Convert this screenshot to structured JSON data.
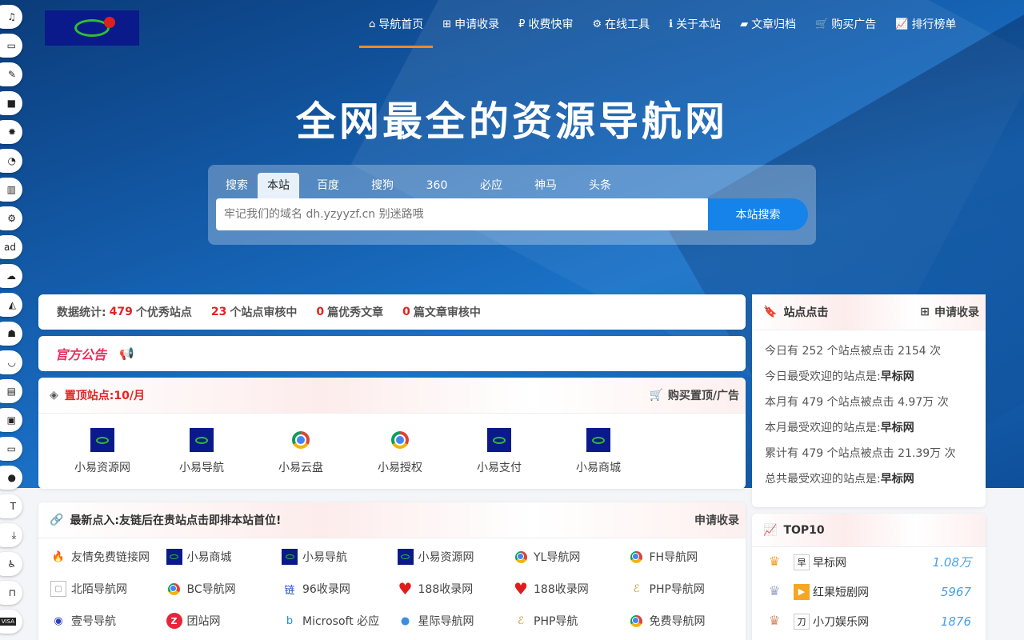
{
  "header": {
    "nav": [
      {
        "icon": "home-icon",
        "glyph": "⌂",
        "label": "导航首页",
        "active": true
      },
      {
        "icon": "plus-square-icon",
        "glyph": "⊞",
        "label": "申请收录"
      },
      {
        "icon": "ruble-icon",
        "glyph": "₽",
        "label": "收费快审"
      },
      {
        "icon": "cogs-icon",
        "glyph": "⚙",
        "label": "在线工具"
      },
      {
        "icon": "info-icon",
        "glyph": "ℹ",
        "label": "关于本站"
      },
      {
        "icon": "folder-open-icon",
        "glyph": "▰",
        "label": "文章归档"
      },
      {
        "icon": "cart-icon",
        "glyph": "🛒",
        "label": "购买广告"
      },
      {
        "icon": "line-chart-icon",
        "glyph": "📈",
        "label": "排行榜单"
      }
    ]
  },
  "hero": {
    "title": "全网最全的资源导航网"
  },
  "search": {
    "tabs": [
      "搜索",
      "本站",
      "百度",
      "搜狗",
      "360",
      "必应",
      "神马",
      "头条"
    ],
    "active_tab": "本站",
    "placeholder": "牢记我们的域名 dh.yzyyzf.cn 别迷路哦",
    "button": "本站搜索"
  },
  "stats": {
    "prefix": "数据统计:",
    "sites": "479",
    "sites_label": "个优秀站点",
    "review": "23",
    "review_label": "个站点审核中",
    "articles": "0",
    "articles_label": "篇优秀文章",
    "articles_review": "0",
    "articles_review_label": "篇文章审核中"
  },
  "notice": {
    "title": "官方公告"
  },
  "top_sites": {
    "title_prefix": "置顶站点:",
    "title_price": "10/月",
    "buy_label": "购买置顶/广告",
    "items": [
      {
        "name": "小易资源网",
        "icon": "navy"
      },
      {
        "name": "小易导航",
        "icon": "navy"
      },
      {
        "name": "小易云盘",
        "icon": "chrome"
      },
      {
        "name": "小易授权",
        "icon": "chrome"
      },
      {
        "name": "小易支付",
        "icon": "navy"
      },
      {
        "name": "小易商城",
        "icon": "navy"
      }
    ]
  },
  "latest": {
    "title": "最新点入:友链后在贵站点击即排本站首位!",
    "apply_label": "申请收录",
    "links": [
      {
        "name": "友情免费链接网",
        "icon": "flame",
        "glyph": "🔥"
      },
      {
        "name": "小易商城",
        "icon": "navy"
      },
      {
        "name": "小易导航",
        "icon": "navy"
      },
      {
        "name": "小易资源网",
        "icon": "navy"
      },
      {
        "name": "YL导航网",
        "icon": "chrome"
      },
      {
        "name": "FH导航网",
        "icon": "chrome"
      },
      {
        "name": "北陌导航网",
        "icon": "broken-image",
        "glyph": "▢"
      },
      {
        "name": "BC导航网",
        "icon": "chrome"
      },
      {
        "name": "96收录网",
        "icon": "link-char",
        "glyph": "链"
      },
      {
        "name": "188收录网",
        "icon": "heart",
        "glyph": "♥"
      },
      {
        "name": "188收录网",
        "icon": "heart",
        "glyph": "♥"
      },
      {
        "name": "PHP导航网",
        "icon": "php-leaf",
        "glyph": "ℰ"
      },
      {
        "name": "壹号导航",
        "icon": "blue-seal",
        "glyph": "◉"
      },
      {
        "name": "团站网",
        "icon": "red-z",
        "glyph": "Z"
      },
      {
        "name": "Microsoft 必应",
        "icon": "bing",
        "glyph": "b"
      },
      {
        "name": "星际导航网",
        "icon": "planet",
        "glyph": "●"
      },
      {
        "name": "PHP导航",
        "icon": "php-leaf",
        "glyph": "ℰ"
      },
      {
        "name": "免费导航网",
        "icon": "chrome"
      }
    ]
  },
  "clicks": {
    "title": "站点点击",
    "apply_label": "申请收录",
    "lines": [
      {
        "text": "今日有 252 个站点被点击 2154 次",
        "bold": ""
      },
      {
        "text": "今日最受欢迎的站点是:",
        "bold": "早标网"
      },
      {
        "text": "本月有 479 个站点被点击 4.97万 次",
        "bold": ""
      },
      {
        "text": "本月最受欢迎的站点是:",
        "bold": "早标网"
      },
      {
        "text": "累计有 479 个站点被点击 21.39万 次",
        "bold": ""
      },
      {
        "text": "总共最受欢迎的站点是:",
        "bold": "早标网"
      }
    ]
  },
  "top10": {
    "title": "TOP10",
    "items": [
      {
        "rank": "1",
        "name": "早标网",
        "value": "1.08万",
        "icon_text": "早"
      },
      {
        "rank": "2",
        "name": "红果短剧网",
        "value": "5967",
        "icon_text": "▶"
      },
      {
        "rank": "3",
        "name": "小刀娱乐网",
        "value": "1876",
        "icon_text": "刀"
      }
    ]
  },
  "leftbar": [
    {
      "icon": "music-icon",
      "glyph": "♫"
    },
    {
      "icon": "credit-card-icon",
      "glyph": "▭"
    },
    {
      "icon": "brush-icon",
      "glyph": "✎"
    },
    {
      "icon": "shopping-bag-icon",
      "glyph": "■"
    },
    {
      "icon": "badge-icon",
      "glyph": "✹"
    },
    {
      "icon": "rss-icon",
      "glyph": "◔"
    },
    {
      "icon": "barcode-icon",
      "glyph": "▥"
    },
    {
      "icon": "cogs-icon",
      "glyph": "⚙"
    },
    {
      "icon": "ad-icon",
      "glyph": "ad"
    },
    {
      "icon": "cloud-upload-icon",
      "glyph": "☁"
    },
    {
      "icon": "area-chart-icon",
      "glyph": "◭"
    },
    {
      "icon": "octopus-icon",
      "glyph": "☗"
    },
    {
      "icon": "edge-icon",
      "glyph": "◡"
    },
    {
      "icon": "briefcase-icon",
      "glyph": "▤"
    },
    {
      "icon": "book-icon",
      "glyph": "▣"
    },
    {
      "icon": "laptop-icon",
      "glyph": "▭"
    },
    {
      "icon": "circle-icon",
      "glyph": "●"
    },
    {
      "icon": "text-height-icon",
      "glyph": "T"
    },
    {
      "icon": "download-icon",
      "glyph": "⤓"
    },
    {
      "icon": "accessibility-icon",
      "glyph": "♿"
    },
    {
      "icon": "archway-icon",
      "glyph": "⊓"
    },
    {
      "icon": "visa-icon",
      "glyph": "VISA"
    }
  ]
}
